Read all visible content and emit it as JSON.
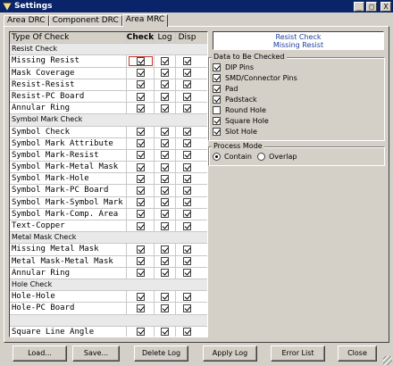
{
  "window": {
    "title": "Settings",
    "minimize": "_",
    "maximize": "□",
    "close": "X"
  },
  "tabs": [
    "Area DRC",
    "Component DRC",
    "Area MRC"
  ],
  "grid": {
    "headers": {
      "type": "Type Of Check",
      "check": "Check",
      "log": "Log",
      "disp": "Disp"
    },
    "rows": [
      {
        "kind": "section",
        "label": "Resist Check"
      },
      {
        "kind": "item",
        "label": "Missing Resist",
        "check": true,
        "log": true,
        "disp": true,
        "selected": true
      },
      {
        "kind": "item",
        "label": "Mask Coverage",
        "check": true,
        "log": true,
        "disp": true
      },
      {
        "kind": "item",
        "label": "Resist-Resist",
        "check": true,
        "log": true,
        "disp": true
      },
      {
        "kind": "item",
        "label": "Resist-PC Board",
        "check": true,
        "log": true,
        "disp": true
      },
      {
        "kind": "item",
        "label": "Annular Ring",
        "check": true,
        "log": true,
        "disp": true
      },
      {
        "kind": "section",
        "label": "Symbol Mark Check"
      },
      {
        "kind": "item",
        "label": "Symbol Check",
        "check": true,
        "log": true,
        "disp": true
      },
      {
        "kind": "item",
        "label": "Symbol Mark Attribute",
        "check": true,
        "log": true,
        "disp": true
      },
      {
        "kind": "item",
        "label": "Symbol Mark-Resist",
        "check": true,
        "log": true,
        "disp": true
      },
      {
        "kind": "item",
        "label": "Symbol Mark-Metal Mask",
        "check": true,
        "log": true,
        "disp": true
      },
      {
        "kind": "item",
        "label": "Symbol Mark-Hole",
        "check": true,
        "log": true,
        "disp": true
      },
      {
        "kind": "item",
        "label": "Symbol Mark-PC Board",
        "check": true,
        "log": true,
        "disp": true
      },
      {
        "kind": "item",
        "label": "Symbol Mark-Symbol Mark",
        "check": true,
        "log": true,
        "disp": true
      },
      {
        "kind": "item",
        "label": "Symbol Mark-Comp. Area",
        "check": true,
        "log": true,
        "disp": true
      },
      {
        "kind": "item",
        "label": "Text-Copper",
        "check": true,
        "log": true,
        "disp": true
      },
      {
        "kind": "section",
        "label": "Metal Mask Check"
      },
      {
        "kind": "item",
        "label": "Missing Metal Mask",
        "check": true,
        "log": true,
        "disp": true
      },
      {
        "kind": "item",
        "label": "Metal Mask-Metal Mask",
        "check": true,
        "log": true,
        "disp": true
      },
      {
        "kind": "item",
        "label": "Annular Ring",
        "check": true,
        "log": true,
        "disp": true
      },
      {
        "kind": "section",
        "label": "Hole Check"
      },
      {
        "kind": "item",
        "label": "Hole-Hole",
        "check": true,
        "log": true,
        "disp": true
      },
      {
        "kind": "item",
        "label": "Hole-PC Board",
        "check": true,
        "log": true,
        "disp": true
      },
      {
        "kind": "spacer",
        "label": ""
      },
      {
        "kind": "item",
        "label": "Square Line Angle",
        "check": true,
        "log": true,
        "disp": true
      }
    ]
  },
  "info": {
    "line1": "Resist Check",
    "line2": "Missing Resist"
  },
  "data_group": {
    "title": "Data to Be Checked",
    "options": [
      {
        "label": "DIP Pins",
        "checked": true
      },
      {
        "label": "SMD/Connector Pins",
        "checked": true
      },
      {
        "label": "Pad",
        "checked": true
      },
      {
        "label": "Padstack",
        "checked": true
      },
      {
        "label": "Round Hole",
        "checked": false
      },
      {
        "label": "Square Hole",
        "checked": true
      },
      {
        "label": "Slot Hole",
        "checked": true
      }
    ]
  },
  "process_group": {
    "title": "Process Mode",
    "options": [
      {
        "label": "Contain",
        "selected": true
      },
      {
        "label": "Overlap",
        "selected": false
      }
    ]
  },
  "buttons": [
    "Load...",
    "Save...",
    "Delete Log",
    "Apply Log",
    "Error List",
    "Close"
  ]
}
